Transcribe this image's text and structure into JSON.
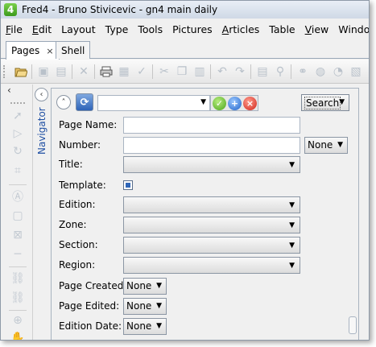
{
  "window": {
    "title": "Fred4 - Bruno Stivicevic - gn4 main daily",
    "logo_text": "4",
    "accent": "#2f66b8"
  },
  "menu": [
    {
      "pre": "",
      "ul": "F",
      "post": "ile"
    },
    {
      "pre": "",
      "ul": "E",
      "post": "dit"
    },
    {
      "pre": "",
      "ul": "",
      "post": "Layout"
    },
    {
      "pre": "",
      "ul": "",
      "post": "Type"
    },
    {
      "pre": "",
      "ul": "",
      "post": "Tools"
    },
    {
      "pre": "",
      "ul": "",
      "post": "Pictures"
    },
    {
      "pre": "",
      "ul": "A",
      "post": "rticles"
    },
    {
      "pre": "",
      "ul": "",
      "post": "Table"
    },
    {
      "pre": "",
      "ul": "V",
      "post": "iew"
    },
    {
      "pre": "",
      "ul": "",
      "post": "Window"
    }
  ],
  "tabs": [
    {
      "label": "Pages",
      "close": "×"
    },
    {
      "label": "Shell"
    }
  ],
  "navigator": {
    "label": "Navigator",
    "collapse_icon": "‹",
    "left_chevron": "‹"
  },
  "panel": {
    "up_icon": "˄",
    "refresh_icon": "⟳",
    "query_value": "",
    "ok_icon": "✓",
    "add_icon": "+",
    "delete_icon": "×",
    "search_label": "Search"
  },
  "form": {
    "page_name": {
      "label": "Page Name:",
      "value": ""
    },
    "number": {
      "label": "Number:",
      "value": "",
      "mode": "None"
    },
    "title": {
      "label": "Title:",
      "value": ""
    },
    "template": {
      "label": "Template:",
      "checked": true
    },
    "edition": {
      "label": "Edition:",
      "value": ""
    },
    "zone": {
      "label": "Zone:",
      "value": ""
    },
    "section": {
      "label": "Section:",
      "value": ""
    },
    "region": {
      "label": "Region:",
      "value": ""
    },
    "page_created": {
      "label": "Page Created:",
      "value": "None"
    },
    "page_edited": {
      "label": "Page Edited:",
      "value": "None"
    },
    "edition_date": {
      "label": "Edition Date:",
      "value": "None"
    }
  },
  "toolbar_icons": [
    "folder-open-icon",
    "save-icon",
    "save-all-icon",
    "close-doc-icon",
    "print-icon",
    "print-preview-icon",
    "spell-check-icon",
    "cut-icon",
    "copy-icon",
    "paste-icon",
    "undo-icon",
    "redo-icon",
    "properties-icon",
    "find-icon",
    "globe-icon",
    "zoom-icon"
  ],
  "tool_icons": [
    "pointer-icon",
    "select-arrow-icon",
    "rotate-icon",
    "crop-icon",
    "text-frame-icon",
    "box-icon",
    "picture-frame-icon",
    "line-icon",
    "link-icon",
    "unlink-icon",
    "zoom-tool-icon",
    "pan-tool-icon"
  ]
}
